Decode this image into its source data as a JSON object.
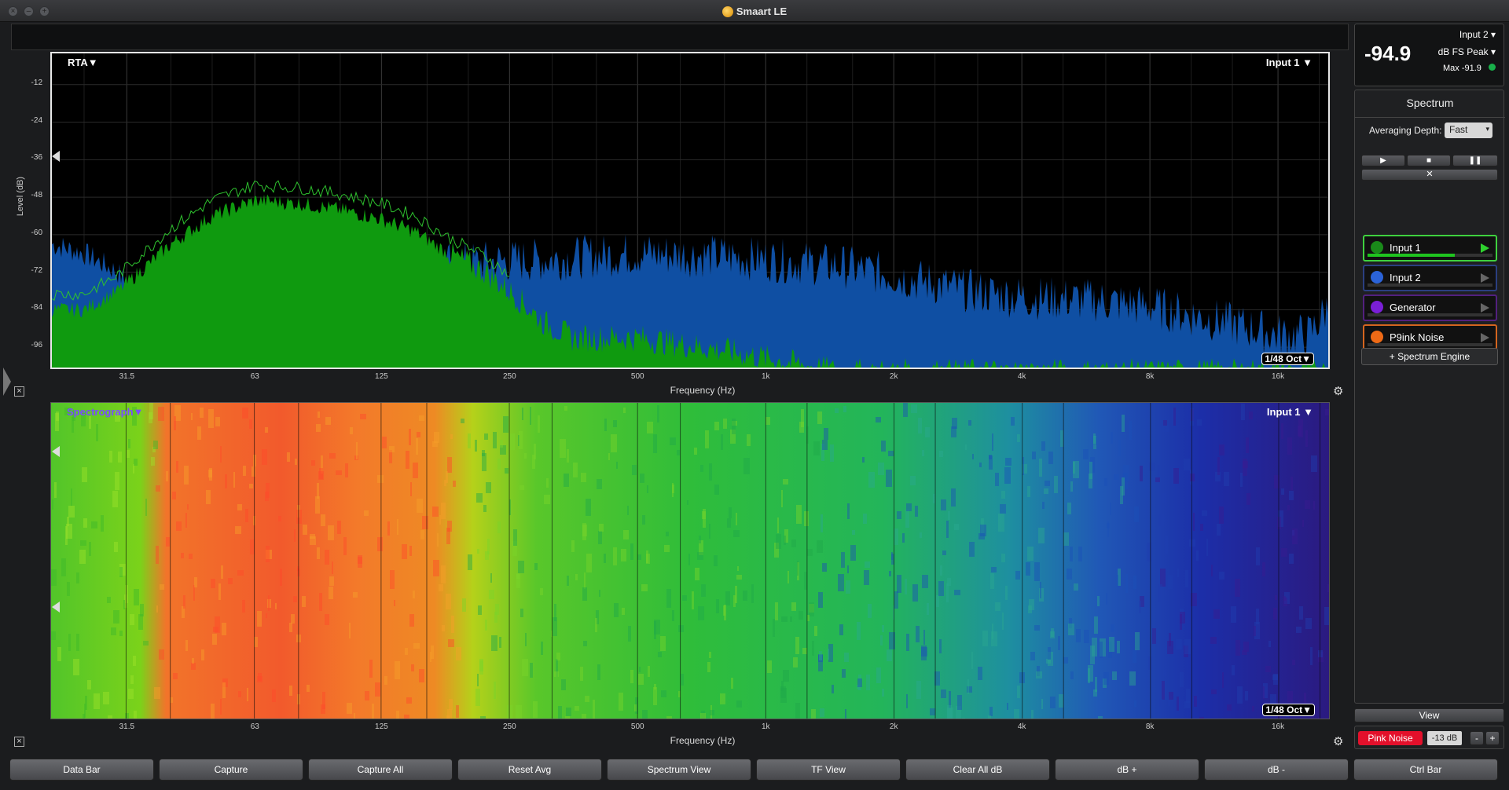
{
  "window": {
    "title": "Smaart LE"
  },
  "rta": {
    "mode_label": "RTA▼",
    "input_label": "Input 1 ▼",
    "octave_label": "1/48 Oct▼",
    "y_axis_title": "Level (dB)",
    "y_ticks": [
      "-12",
      "-24",
      "-36",
      "-48",
      "-60",
      "-72",
      "-84",
      "-96"
    ],
    "x_axis_title": "Frequency (Hz)",
    "x_ticks": [
      "31.5",
      "63",
      "125",
      "250",
      "500",
      "1k",
      "2k",
      "4k",
      "8k",
      "16k"
    ],
    "colors": {
      "input1": "#0f9a0f",
      "input2": "#0f4fa3",
      "background": "#000000"
    }
  },
  "spectrograph": {
    "mode_label": "Spectrograph▼",
    "input_label": "Input 1 ▼",
    "octave_label": "1/48 Oct▼",
    "x_axis_title": "Frequency (Hz)",
    "x_ticks": [
      "31.5",
      "63",
      "125",
      "250",
      "500",
      "1k",
      "2k",
      "4k",
      "8k",
      "16k"
    ]
  },
  "meter": {
    "value": "-94.9",
    "input": "Input 2",
    "units": "dB FS Peak",
    "max": "Max -91.9",
    "status_color": "#18b04a"
  },
  "side": {
    "title": "Spectrum",
    "averaging_label": "Averaging Depth:",
    "averaging_value": "Fast",
    "sources": [
      {
        "name": "Input 1",
        "color": "#1a8a1a",
        "border": "#3fd13f",
        "level": 0.7
      },
      {
        "name": "Input 2",
        "color": "#2b63d8",
        "border": "#2b3f80",
        "level": 0.0
      },
      {
        "name": "Generator",
        "color": "#7a1fd6",
        "border": "#52207e",
        "level": 0.0
      },
      {
        "name": "P9ink Noise",
        "color": "#ee6a16",
        "border": "#d4651f",
        "level": 0.0
      }
    ],
    "add_engine": "+ Spectrum Engine",
    "view_label": "View",
    "pink_noise_button": "Pink Noise",
    "generator_level": "-13 dB",
    "minus_label": "-",
    "plus_label": "+"
  },
  "bottom_bar": {
    "buttons": [
      "Data Bar",
      "Capture",
      "Capture All",
      "Reset Avg",
      "Spectrum View",
      "TF View",
      "Clear All dB",
      "dB +",
      "dB -",
      "Ctrl Bar"
    ]
  }
}
